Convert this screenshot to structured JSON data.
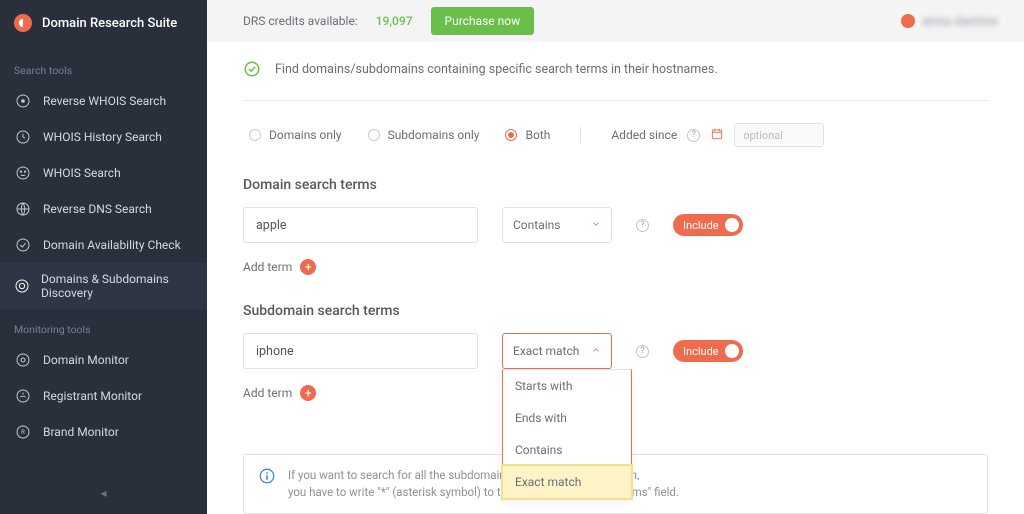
{
  "brand": {
    "title": "Domain Research Suite"
  },
  "sidebar": {
    "section1": "Search tools",
    "section2": "Monitoring tools",
    "items1": [
      {
        "label": "Reverse WHOIS Search"
      },
      {
        "label": "WHOIS History Search"
      },
      {
        "label": "WHOIS Search"
      },
      {
        "label": "Reverse DNS Search"
      },
      {
        "label": "Domain Availability Check"
      },
      {
        "label": "Domains & Subdomains Discovery"
      }
    ],
    "items2": [
      {
        "label": "Domain Monitor"
      },
      {
        "label": "Registrant Monitor"
      },
      {
        "label": "Brand Monitor"
      }
    ]
  },
  "topbar": {
    "credits_label": "DRS credits available:",
    "credits_value": "19,097",
    "purchase": "Purchase now",
    "username": "anna.dantine"
  },
  "hint": "Find domains/subdomains containing specific search terms in their hostnames.",
  "scope": {
    "opt1": "Domains only",
    "opt2": "Subdomains only",
    "opt3": "Both",
    "added_since_label": "Added since",
    "date_placeholder": "optional"
  },
  "domain_terms": {
    "title": "Domain search terms",
    "value": "apple",
    "match_label": "Contains",
    "include_label": "Include",
    "add_term": "Add term"
  },
  "sub_terms": {
    "title": "Subdomain search terms",
    "value": "iphone",
    "match_label": "Exact match",
    "include_label": "Include",
    "add_term": "Add term"
  },
  "dropdown": {
    "opt1": "Starts with",
    "opt2": "Ends with",
    "opt3": "Contains",
    "opt4": "Exact match"
  },
  "info": {
    "line1": "If you want to search for all the subdomains of the particular domain,",
    "line2": "you have to write \"*\" (asterisk symbol) to the \"Subdomain search terms\" field."
  }
}
